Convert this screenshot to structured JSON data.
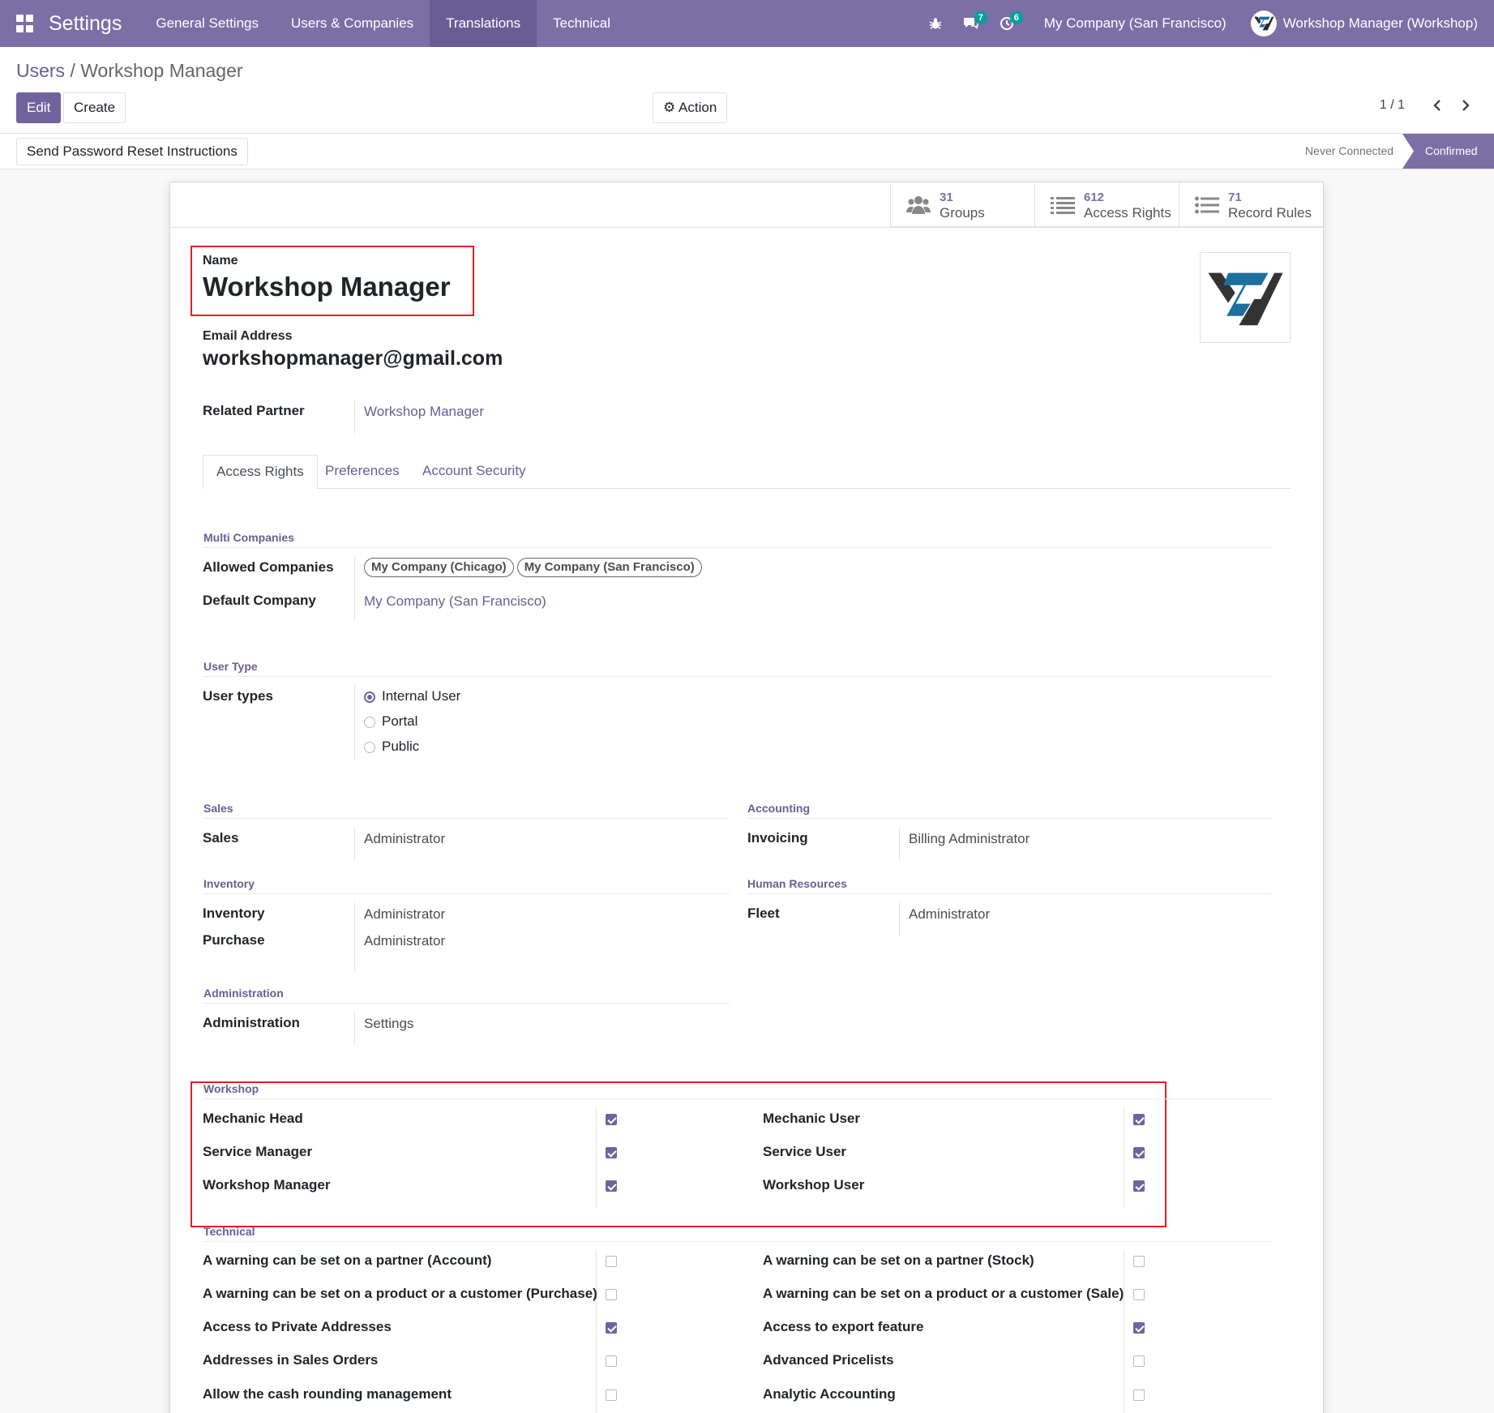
{
  "navbar": {
    "brand": "Settings",
    "menu": [
      "General Settings",
      "Users & Companies",
      "Translations",
      "Technical"
    ],
    "active_menu": "Translations",
    "messages_badge": "7",
    "activities_badge": "6",
    "company": "My Company (San Francisco)",
    "user": "Workshop Manager (Workshop)"
  },
  "breadcrumb": {
    "parent": "Users",
    "separator": "/",
    "current": "Workshop Manager"
  },
  "toolbar": {
    "edit_label": "Edit",
    "create_label": "Create",
    "action_label": "Action",
    "pager": "1 / 1"
  },
  "statusbar": {
    "reset_label": "Send Password Reset Instructions",
    "never_connected": "Never Connected",
    "confirmed": "Confirmed"
  },
  "stats": [
    {
      "value": "31",
      "label": "Groups"
    },
    {
      "value": "612",
      "label": "Access Rights"
    },
    {
      "value": "71",
      "label": "Record Rules"
    }
  ],
  "user": {
    "name_label": "Name",
    "name": "Workshop Manager",
    "email_label": "Email Address",
    "email": "workshopmanager@gmail.com",
    "partner_label": "Related Partner",
    "partner": "Workshop Manager"
  },
  "tabs": [
    "Access Rights",
    "Preferences",
    "Account Security"
  ],
  "multi_companies": {
    "title": "Multi Companies",
    "allowed_label": "Allowed Companies",
    "allowed": [
      "My Company (Chicago)",
      "My Company (San Francisco)"
    ],
    "default_label": "Default Company",
    "default": "My Company (San Francisco)"
  },
  "user_type": {
    "title": "User Type",
    "label": "User types",
    "options": [
      "Internal User",
      "Portal",
      "Public"
    ],
    "selected": "Internal User"
  },
  "apps": {
    "sales": {
      "title": "Sales",
      "label": "Sales",
      "value": "Administrator"
    },
    "accounting": {
      "title": "Accounting",
      "label": "Invoicing",
      "value": "Billing Administrator"
    },
    "inventory": {
      "title": "Inventory",
      "inventory_label": "Inventory",
      "inventory_value": "Administrator",
      "purchase_label": "Purchase",
      "purchase_value": "Administrator"
    },
    "hr": {
      "title": "Human Resources",
      "label": "Fleet",
      "value": "Administrator"
    },
    "administration": {
      "title": "Administration",
      "label": "Administration",
      "value": "Settings"
    }
  },
  "workshop": {
    "title": "Workshop",
    "left": [
      {
        "label": "Mechanic Head",
        "checked": true
      },
      {
        "label": "Service Manager",
        "checked": true
      },
      {
        "label": "Workshop Manager",
        "checked": true
      }
    ],
    "right": [
      {
        "label": "Mechanic User",
        "checked": true
      },
      {
        "label": "Service User",
        "checked": true
      },
      {
        "label": "Workshop User",
        "checked": true
      }
    ]
  },
  "technical": {
    "title": "Technical",
    "left": [
      {
        "label": "A warning can be set on a partner (Account)",
        "checked": false
      },
      {
        "label": "A warning can be set on a product or a customer (Purchase)",
        "checked": false
      },
      {
        "label": "Access to Private Addresses",
        "checked": true
      },
      {
        "label": "Addresses in Sales Orders",
        "checked": false
      },
      {
        "label": "Allow the cash rounding management",
        "checked": false
      }
    ],
    "right": [
      {
        "label": "A warning can be set on a partner (Stock)",
        "checked": false
      },
      {
        "label": "A warning can be set on a product or a customer (Sale)",
        "checked": false
      },
      {
        "label": "Access to export feature",
        "checked": true
      },
      {
        "label": "Advanced Pricelists",
        "checked": false
      },
      {
        "label": "Analytic Accounting",
        "checked": false
      }
    ]
  },
  "colors": {
    "brand": "#7c6fa6",
    "link": "#6a5d95",
    "badge": "#00a09d",
    "highlight": "#e41e26"
  },
  "icons": [
    "apps-icon",
    "bug-icon",
    "chat-icon",
    "clock-icon",
    "users-icon",
    "list-icon",
    "gear-icon",
    "chevron-left-icon",
    "chevron-right-icon"
  ]
}
